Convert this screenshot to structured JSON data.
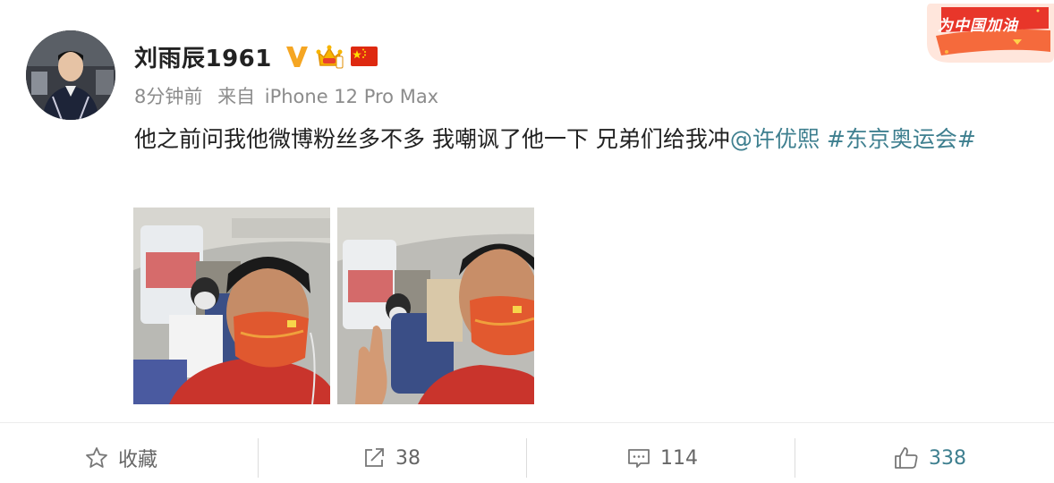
{
  "post": {
    "author": "刘雨辰1961",
    "time": "8分钟前",
    "source_prefix": "来自",
    "source_device": "iPhone 12 Pro Max",
    "text_main": "他之前问我他微博粉丝多不多 我嘲讽了他一下 兄弟们给我冲",
    "mention": "@许优熙",
    "topic": "#东京奥运会#"
  },
  "badges": {
    "topic_badge_text": "为中国加油"
  },
  "actions": {
    "favorite_label": "收藏",
    "share_count": "38",
    "comment_count": "114",
    "like_count": "338"
  },
  "icons": [
    "avatar",
    "verified-v-icon",
    "crown-icon",
    "china-flag-icon",
    "star-icon",
    "share-icon",
    "comment-icon",
    "thumbs-up-icon"
  ],
  "colors": {
    "link": "#3e7f8f",
    "meta": "#8c8c8c",
    "verified": "#f5a623"
  }
}
